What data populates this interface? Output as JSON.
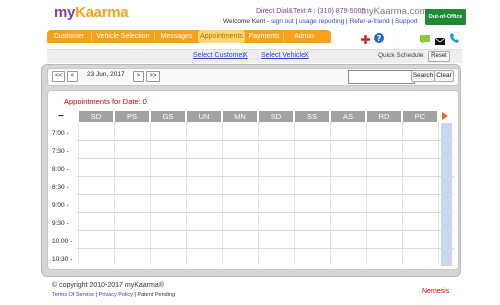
{
  "header": {
    "logo_part1": "my",
    "logo_part2": "Kaarma",
    "dial_text": "Direct Dial&Text # : (310) 879-5005",
    "site_name": "myKaarma.com",
    "welcome_prefix": "Welcome Kent -",
    "links": [
      "sign out",
      "usage reporting",
      "Refer-a-friend",
      "Support"
    ],
    "out_of_office_label": "Out-of-Office"
  },
  "nav": {
    "tabs": [
      "Customer",
      "Vehicle Selection",
      "Messages",
      "Appointments",
      "Payments",
      "Admin"
    ],
    "active_tab": "Appointments"
  },
  "top_icons": [
    "add-icon",
    "help-icon",
    "chat-icon",
    "mail-icon",
    "phone-icon"
  ],
  "selection": {
    "select_customer": "Select Customer",
    "select_vehicle": "Select Vehicle",
    "clear_x": "X",
    "quick_schedule": "Quick Schedule",
    "reset_label": "Reset"
  },
  "datebar": {
    "first": "<<",
    "prev_page": "<",
    "date": "23 Jun, 2017",
    "next_page": ">",
    "last": ">>",
    "search_value": "",
    "search_label": "Search",
    "clear_label": "Clear"
  },
  "calendar": {
    "appointments_label": "Appointments for Date: 0",
    "collapse_symbol": "−",
    "columns": [
      "SD",
      "PS",
      "GS",
      "UN",
      "MN",
      "SD",
      "SS",
      "AS",
      "RD",
      "PC"
    ],
    "times": [
      "7:00 -",
      "7:30 -",
      "8:00 -",
      "8:30 -",
      "9:00 -",
      "9:30 -",
      "10:00 -",
      "10:30 -"
    ]
  },
  "footer": {
    "copyright": "© copyright 2010-2017 myKaarma®",
    "terms": "Terms Of Service",
    "privacy": "Privacy Policy",
    "patent": "Patent Pending",
    "brand": "Nemesis"
  },
  "colors": {
    "brand_purple": "#7e3f98",
    "brand_orange": "#f6a01b",
    "link_blue": "#2b3fcf",
    "alert_red": "#d80000",
    "ooo_green": "#1e8a36"
  }
}
